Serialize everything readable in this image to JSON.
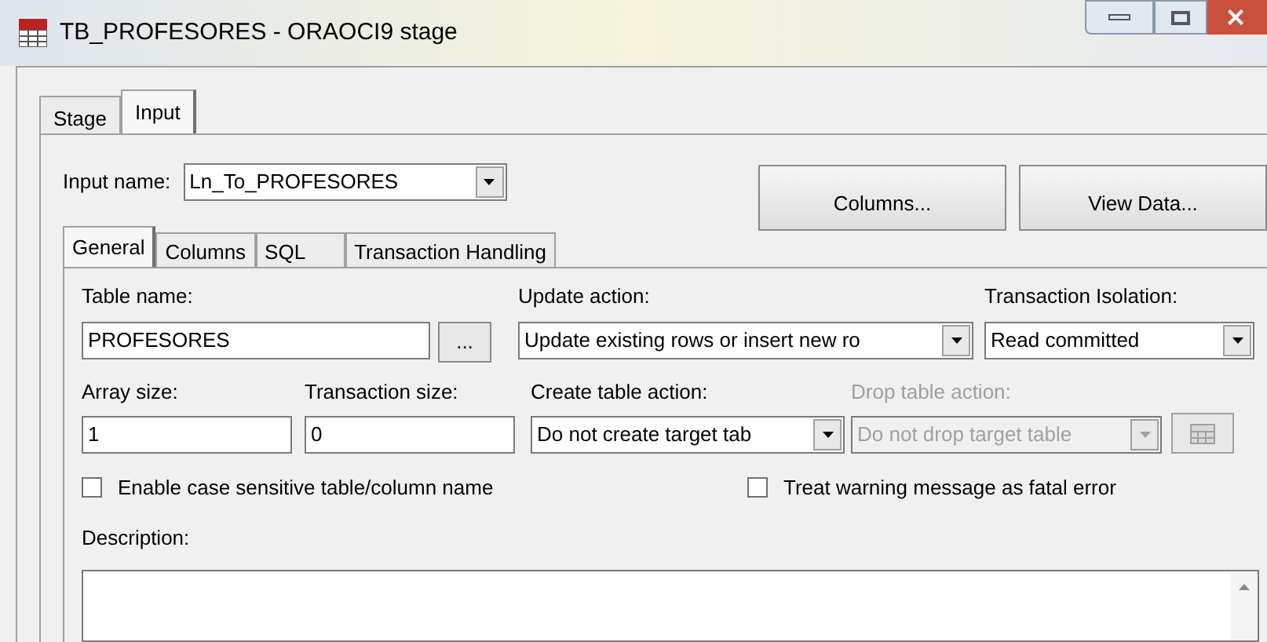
{
  "window": {
    "title": "TB_PROFESORES - ORAOCI9 stage"
  },
  "tabs": [
    {
      "label": "Stage",
      "selected": false
    },
    {
      "label": "Input",
      "selected": true
    }
  ],
  "input_name": {
    "label": "Input name:",
    "value": "Ln_To_PROFESORES"
  },
  "buttons": [
    "Columns...",
    "View Data..."
  ],
  "subtabs": [
    {
      "label": "General",
      "selected": true
    },
    {
      "label": "Columns",
      "selected": false
    },
    {
      "label": "SQL",
      "selected": false
    },
    {
      "label": "Transaction Handling",
      "selected": false
    }
  ],
  "table_name": {
    "label": "Table name:",
    "value": "PROFESORES",
    "browse": "..."
  },
  "update_action": {
    "label": "Update action:",
    "value": "Update existing rows or insert new ro",
    "disabled": false
  },
  "transaction_isolation": {
    "label": "Transaction Isolation:",
    "value": "Read committed",
    "disabled": false
  },
  "array_size": {
    "label": "Array size:",
    "value": "1"
  },
  "transaction_size": {
    "label": "Transaction size:",
    "value": "0"
  },
  "create_table_action": {
    "label": "Create table action:",
    "value": "Do not create target tab",
    "disabled": false
  },
  "drop_table_action": {
    "label": "Drop table action:",
    "value": "Do not drop target table",
    "disabled": true
  },
  "checkboxes": [
    {
      "label": "Enable case sensitive table/column name",
      "checked": false
    },
    {
      "label": "Treat warning message as fatal error",
      "checked": false
    }
  ],
  "description": {
    "label": "Description:"
  }
}
